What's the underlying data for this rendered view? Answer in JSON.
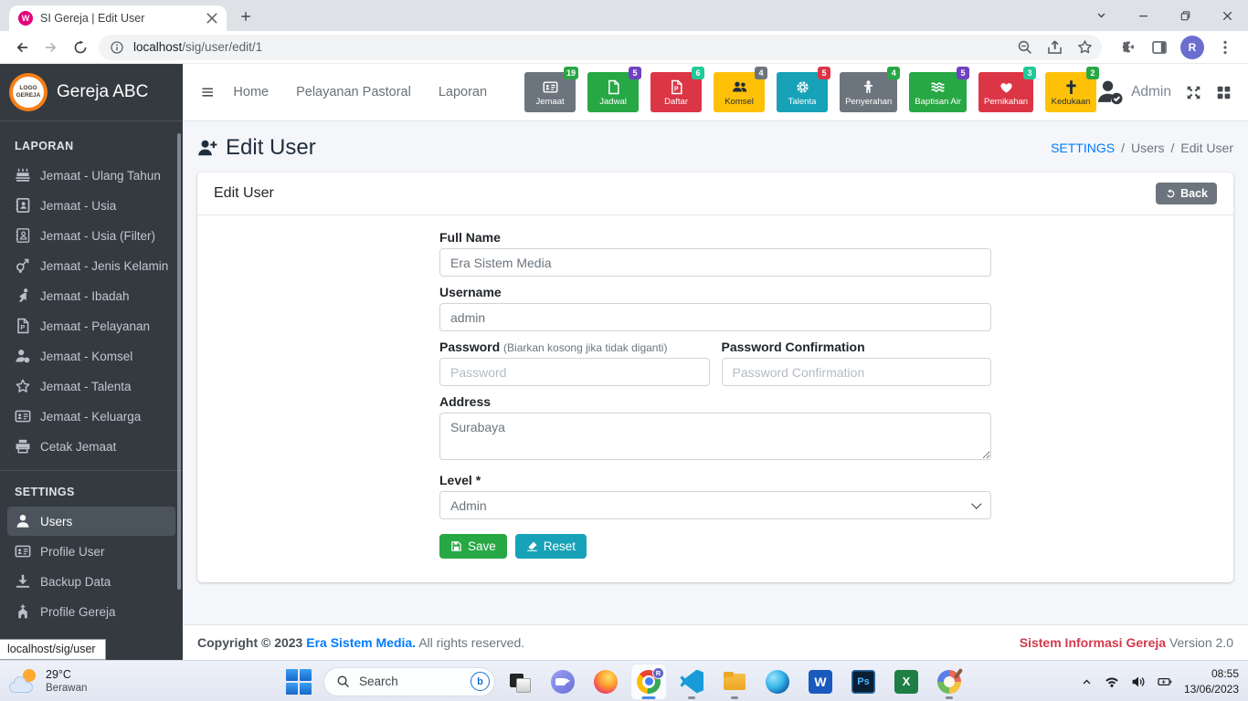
{
  "browser": {
    "tab_title": "SI Gereja | Edit User",
    "url_host": "localhost",
    "url_path": "/sig/user/edit/1",
    "profile_initial": "R"
  },
  "sidebar": {
    "brand": "Gereja ABC",
    "logo_text": "LOGO GEREJA",
    "sections": [
      {
        "header": "LAPORAN",
        "items": [
          {
            "label": "Jemaat - Ulang Tahun",
            "icon": "birthday-cake"
          },
          {
            "label": "Jemaat - Usia",
            "icon": "address-book"
          },
          {
            "label": "Jemaat - Usia (Filter)",
            "icon": "address-book-o"
          },
          {
            "label": "Jemaat - Jenis Kelamin",
            "icon": "venus-mars"
          },
          {
            "label": "Jemaat - Ibadah",
            "icon": "praying"
          },
          {
            "label": "Jemaat - Pelayanan",
            "icon": "file-p"
          },
          {
            "label": "Jemaat - Komsel",
            "icon": "user-tag"
          },
          {
            "label": "Jemaat - Talenta",
            "icon": "star-o"
          },
          {
            "label": "Jemaat - Keluarga",
            "icon": "id-card"
          },
          {
            "label": "Cetak Jemaat",
            "icon": "print"
          }
        ]
      },
      {
        "header": "SETTINGS",
        "items": [
          {
            "label": "Users",
            "icon": "user",
            "active": true
          },
          {
            "label": "Profile User",
            "icon": "id-card"
          },
          {
            "label": "Backup Data",
            "icon": "download"
          },
          {
            "label": "Profile Gereja",
            "icon": "church"
          }
        ]
      }
    ]
  },
  "navbar": {
    "links": [
      "Home",
      "Pelayanan Pastoral",
      "Laporan"
    ],
    "username": "Admin",
    "tiles": [
      {
        "label": "Jemaat",
        "badge": "19",
        "color": "#6c757d",
        "badge_color": "#28a745",
        "text": "#ffffff",
        "icon": "id-card"
      },
      {
        "label": "Jadwal",
        "badge": "5",
        "color": "#28a745",
        "badge_color": "#6f42c1",
        "text": "#ffffff",
        "icon": "file"
      },
      {
        "label": "Daftar",
        "badge": "6",
        "color": "#dc3545",
        "badge_color": "#20c997",
        "text": "#ffffff",
        "icon": "file-p"
      },
      {
        "label": "Komsel",
        "badge": "4",
        "color": "#ffc107",
        "badge_color": "#6c757d",
        "text": "#1f2d3d",
        "icon": "users"
      },
      {
        "label": "Talenta",
        "badge": "5",
        "color": "#17a2b8",
        "badge_color": "#dc3545",
        "text": "#ffffff",
        "icon": "gear"
      },
      {
        "label": "Penyerahan",
        "badge": "4",
        "color": "#6c757d",
        "badge_color": "#28a745",
        "text": "#ffffff",
        "icon": "child"
      },
      {
        "label": "Baptisan Air",
        "badge": "5",
        "color": "#28a745",
        "badge_color": "#6f42c1",
        "text": "#ffffff",
        "icon": "water"
      },
      {
        "label": "Pernikahan",
        "badge": "3",
        "color": "#dc3545",
        "badge_color": "#20c997",
        "text": "#ffffff",
        "icon": "heart"
      },
      {
        "label": "Kedukaan",
        "badge": "2",
        "color": "#ffc107",
        "badge_color": "#28a745",
        "text": "#1f2d3d",
        "icon": "cross"
      }
    ]
  },
  "page": {
    "title": "Edit User",
    "breadcrumb": {
      "link": "SETTINGS",
      "middle": "Users",
      "current": "Edit User"
    },
    "card": {
      "title": "Edit User",
      "back_label": "Back",
      "fields": {
        "full_name": {
          "label": "Full Name",
          "value": "Era Sistem Media"
        },
        "username": {
          "label": "Username",
          "value": "admin"
        },
        "password": {
          "label": "Password",
          "note": "(Biarkan kosong jika tidak diganti)",
          "placeholder": "Password"
        },
        "password_confirmation": {
          "label": "Password Confirmation",
          "placeholder": "Password Confirmation"
        },
        "address": {
          "label": "Address",
          "value": "Surabaya"
        },
        "level": {
          "label": "Level *",
          "value": "Admin"
        }
      },
      "save_label": "Save",
      "reset_label": "Reset"
    }
  },
  "footer": {
    "copyright_prefix": "Copyright © 2023",
    "company": "Era Sistem Media.",
    "rights": "All rights reserved.",
    "app_name": "Sistem Informasi Gereja",
    "version": "Version 2.0"
  },
  "status_tooltip": "localhost/sig/user",
  "taskbar": {
    "weather_temp": "29°C",
    "weather_desc": "Berawan",
    "search_placeholder": "Search",
    "time": "08:55",
    "date": "13/06/2023",
    "app_icons": [
      {
        "name": "task-view",
        "running": false,
        "active": false
      },
      {
        "name": "chat",
        "running": false,
        "active": false
      },
      {
        "name": "firefox",
        "running": false,
        "active": false
      },
      {
        "name": "chrome",
        "running": true,
        "active": true
      },
      {
        "name": "vscode",
        "running": true,
        "active": false
      },
      {
        "name": "file-explorer",
        "running": true,
        "active": false
      },
      {
        "name": "edge",
        "running": false,
        "active": false
      },
      {
        "name": "word",
        "running": false,
        "active": false
      },
      {
        "name": "photoshop",
        "running": false,
        "active": false
      },
      {
        "name": "excel",
        "running": false,
        "active": false
      },
      {
        "name": "paint",
        "running": true,
        "active": false
      }
    ]
  }
}
